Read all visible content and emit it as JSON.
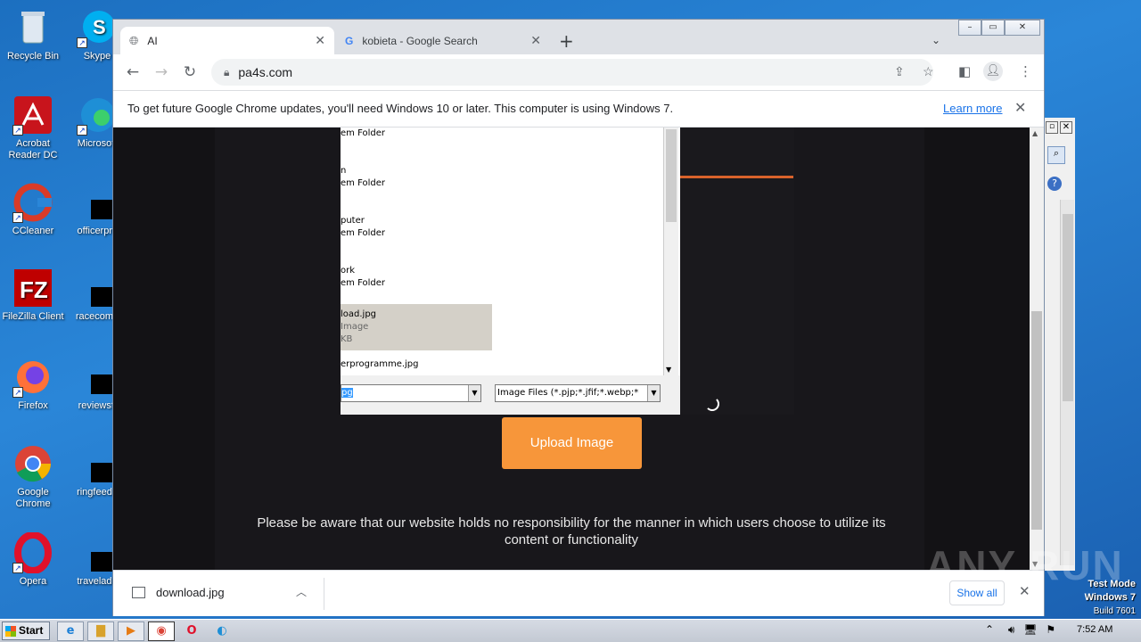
{
  "desktop": {
    "icons": [
      {
        "label": "Recycle Bin"
      },
      {
        "label": "Skype"
      },
      {
        "label": "Acrobat Reader DC"
      },
      {
        "label": "Microsoft"
      },
      {
        "label": "CCleaner"
      },
      {
        "label": "officerprc"
      },
      {
        "label": "FileZilla Client"
      },
      {
        "label": "racecomp"
      },
      {
        "label": "Firefox"
      },
      {
        "label": "reviewsfi"
      },
      {
        "label": "Google Chrome"
      },
      {
        "label": "ringfeedb"
      },
      {
        "label": "Opera"
      },
      {
        "label": "traveladd"
      }
    ]
  },
  "browser": {
    "tabs": [
      {
        "title": "AI",
        "icon": "globe-icon"
      },
      {
        "title": "kobieta - Google Search",
        "icon": "google-icon"
      }
    ],
    "url": "pa4s.com",
    "infobar": {
      "message": "To get future Google Chrome updates, you'll need Windows 10 or later. This computer is using Windows 7.",
      "link": "Learn more"
    }
  },
  "page": {
    "dialog": {
      "items": [
        {
          "name": "em Folder"
        },
        {
          "name": "n"
        },
        {
          "name": "em Folder"
        },
        {
          "name": "puter"
        },
        {
          "name": "em Folder"
        },
        {
          "name": "ork"
        },
        {
          "name": "em Folder"
        },
        {
          "name": "load.jpg"
        },
        {
          "name": "Image"
        },
        {
          "name": "KB"
        },
        {
          "name": "erprogramme.jpg"
        }
      ],
      "filename": "pg",
      "filetype": "Image Files (*.pjp;*.jfif;*.webp;*"
    },
    "upload_button": "Upload Image",
    "disclaimer": "Please be aware that our website holds no responsibility for the manner in which users choose to utilize its content or functionality"
  },
  "downloads": {
    "file": "download.jpg",
    "show_all": "Show all"
  },
  "taskbar": {
    "start": "Start",
    "time": "7:52 AM"
  },
  "watermark": {
    "line1": "Test Mode",
    "line2": "Windows 7",
    "line3": "Build 7601",
    "brand": "ANY RUN"
  }
}
